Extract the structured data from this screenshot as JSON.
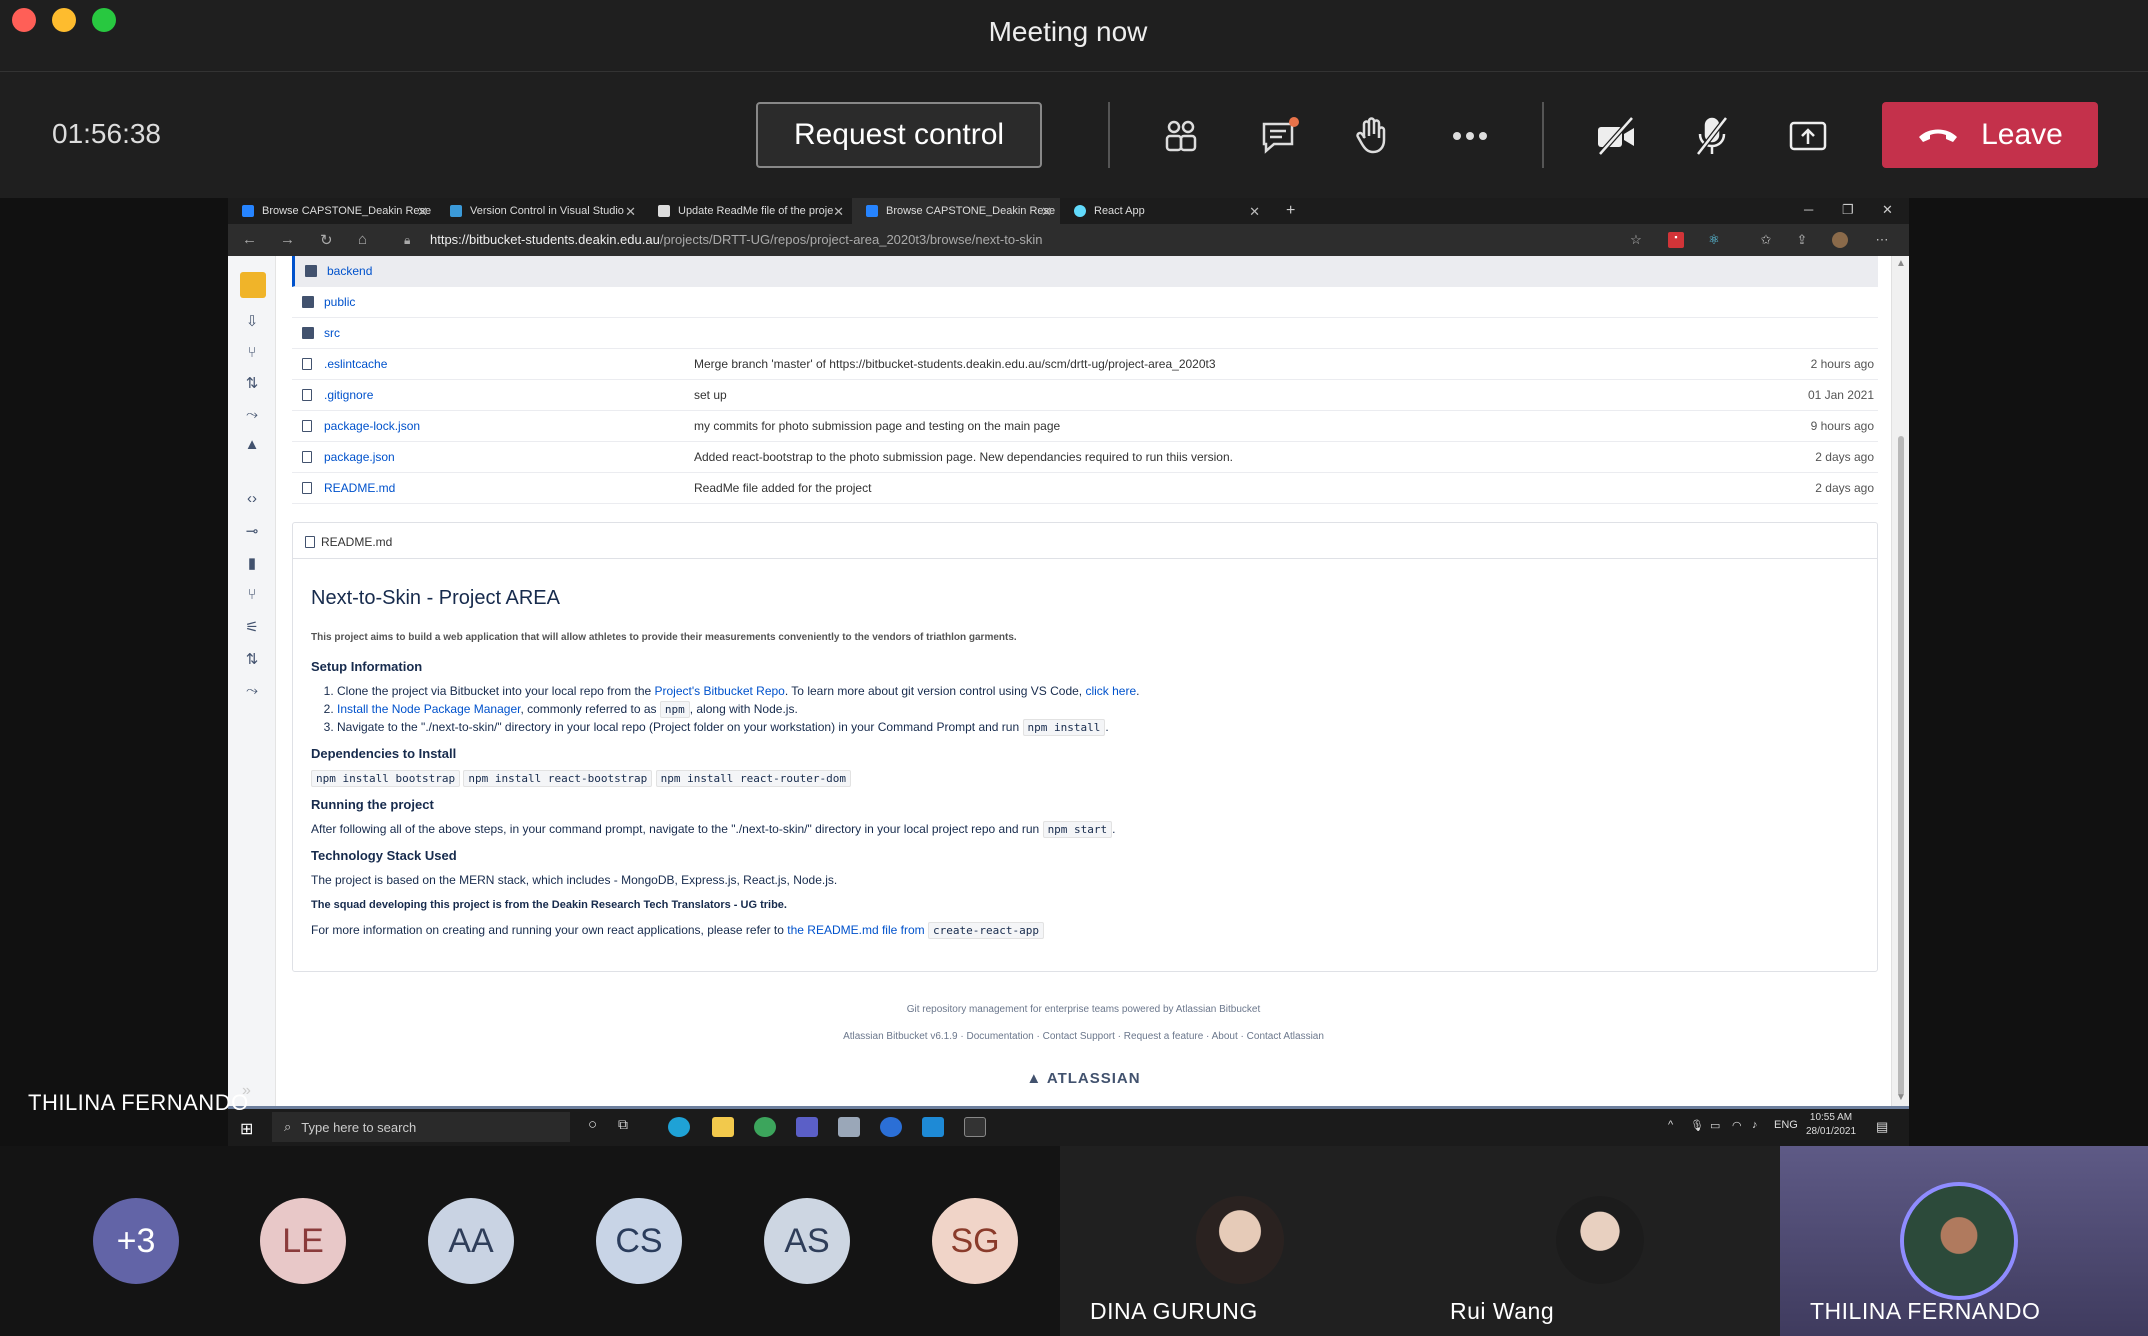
{
  "meeting": {
    "title": "Meeting now",
    "timer": "01:56:38",
    "request_control_label": "Request control",
    "leave_label": "Leave"
  },
  "browser": {
    "tabs": [
      {
        "label": "Browse CAPSTONE_Deakin Rese",
        "favicon_color": "#2684ff",
        "active": false
      },
      {
        "label": "Version Control in Visual Studio",
        "favicon_color": "#3b9ad9",
        "active": false
      },
      {
        "label": "Update ReadMe file of the proje",
        "favicon_color": "#dddddd",
        "active": false
      },
      {
        "label": "Browse CAPSTONE_Deakin Rese",
        "favicon_color": "#2684ff",
        "active": true
      },
      {
        "label": "React App",
        "favicon_color": "#61dafb",
        "active": false
      }
    ],
    "url_host": "https://bitbucket-students.deakin.edu.au",
    "url_path": "/projects/DRTT-UG/repos/project-area_2020t3/browse/next-to-skin"
  },
  "repo": {
    "files": [
      {
        "name": "backend",
        "type": "folder",
        "message": "",
        "when": ""
      },
      {
        "name": "public",
        "type": "folder",
        "message": "",
        "when": ""
      },
      {
        "name": "src",
        "type": "folder",
        "message": "",
        "when": ""
      },
      {
        "name": ".eslintcache",
        "type": "file",
        "message": "Merge branch 'master' of https://bitbucket-students.deakin.edu.au/scm/drtt-ug/project-area_2020t3",
        "when": "2 hours ago"
      },
      {
        "name": ".gitignore",
        "type": "file",
        "message": "set up",
        "when": "01 Jan 2021"
      },
      {
        "name": "package-lock.json",
        "type": "file",
        "message": "my commits for photo submission page and testing on the main page",
        "when": "9 hours ago"
      },
      {
        "name": "package.json",
        "type": "file",
        "message": "Added react-bootstrap to the photo submission page. New dependancies required to run thiis version.",
        "when": "2 days ago"
      },
      {
        "name": "README.md",
        "type": "file",
        "message": "ReadMe file added for the project",
        "when": "2 days ago"
      }
    ]
  },
  "readme": {
    "filename": "README.md",
    "h1": "Next-to-Skin - Project AREA",
    "intro": "This project aims to build a web application that will allow athletes to provide their measurements conveniently to the vendors of triathlon garments.",
    "setup_heading": "Setup Information",
    "setup_1a": "Clone the project via Bitbucket into your local repo from the ",
    "setup_1_link": "Project's Bitbucket Repo",
    "setup_1b": ". To learn more about git version control using VS Code, ",
    "setup_1_link2": "click here",
    "setup_1c": ".",
    "setup_2_link": "Install the Node Package Manager",
    "setup_2a": ", commonly referred to as ",
    "setup_2_code": "npm",
    "setup_2b": ", along with Node.js.",
    "setup_3a": "Navigate to the \"./next-to-skin/\" directory in your local repo (Project folder on your workstation) in your Command Prompt and run ",
    "setup_3_code": "npm install",
    "setup_3b": ".",
    "deps_heading": "Dependencies to Install",
    "deps": [
      "npm install bootstrap",
      "npm install react-bootstrap",
      "npm install react-router-dom"
    ],
    "running_heading": "Running the project",
    "running_a": "After following all of the above steps, in your command prompt, navigate to the \"./next-to-skin/\" directory in your local project repo and run ",
    "running_code": "npm start",
    "running_b": ".",
    "stack_heading": "Technology Stack Used",
    "stack_text": "The project is based on the MERN stack, which includes - MongoDB, Express.js, React.js, Node.js.",
    "squad_text": "The squad developing this project is from the Deakin Research Tech Translators - UG tribe.",
    "more_a": "For more information on creating and running your own react applications, please refer to ",
    "more_link": "the README.md file from",
    "more_code": "create-react-app"
  },
  "footer": {
    "line1": "Git repository management for enterprise teams powered by Atlassian Bitbucket",
    "links": [
      "Atlassian Bitbucket v6.1.9",
      "Documentation",
      "Contact Support",
      "Request a feature",
      "About",
      "Contact Atlassian"
    ],
    "brand": "ATLASSIAN"
  },
  "taskbar": {
    "search_placeholder": "Type here to search",
    "lang": "ENG",
    "time": "10:55 AM",
    "date": "28/01/2021"
  },
  "sharer_name": "THILINA FERNANDO",
  "participants": {
    "overflow": "+3",
    "initials": [
      {
        "text": "LE",
        "bg": "#e8c8c8"
      },
      {
        "text": "AA",
        "bg": "#c9d3e3"
      },
      {
        "text": "CS",
        "bg": "#c8d4e6"
      },
      {
        "text": "AS",
        "bg": "#cdd6e2"
      },
      {
        "text": "SG",
        "bg": "#f0d4c8"
      }
    ],
    "video_tiles": [
      "DINA GURUNG",
      "Rui Wang",
      "THILINA FERNANDO"
    ]
  },
  "colors": {
    "leave": "#c4314b",
    "overflow_avatar": "#6264a7",
    "link": "#0052cc"
  }
}
